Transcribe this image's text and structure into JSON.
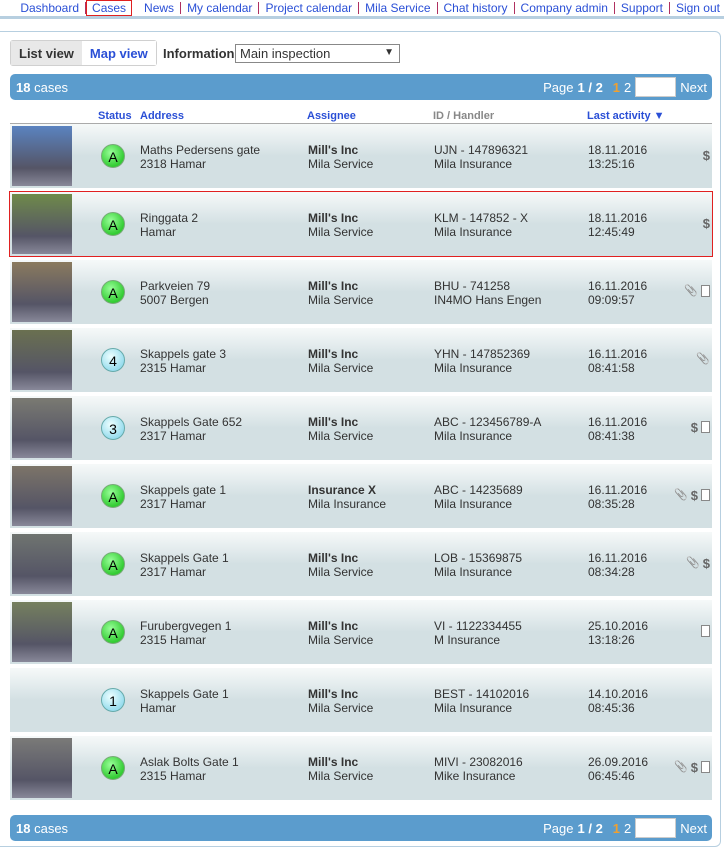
{
  "nav": [
    "Dashboard",
    "Cases",
    "News",
    "My calendar",
    "Project calendar",
    "Mila Service",
    "Chat history",
    "Company admin",
    "Support",
    "Sign out"
  ],
  "nav_active": "Cases",
  "view": {
    "list": "List view",
    "map": "Map view"
  },
  "info": {
    "label": "Information:",
    "value": "Main inspection"
  },
  "summary": {
    "count": "18",
    "count_label": "cases",
    "page_label": "Page",
    "page": "1 / 2",
    "current": "1",
    "other": "2",
    "next": "Next"
  },
  "headers": {
    "status": "Status",
    "address": "Address",
    "assignee": "Assignee",
    "id": "ID / Handler",
    "activity": "Last activity ▼"
  },
  "rows": [
    {
      "thumb": "#5a83c0",
      "status": "A",
      "color": "green",
      "addr1": "Maths Pedersens gate",
      "addr2": "2318 Hamar",
      "ass1": "Mill's Inc",
      "ass2": "Mila Service",
      "id1": "UJN - 147896321",
      "id2": "Mila Insurance",
      "date": "18.11.2016",
      "time": "13:25:16",
      "icons": [
        "dollar"
      ]
    },
    {
      "thumb": "#6f8a4a",
      "status": "A",
      "color": "green",
      "addr1": "Ringgata 2",
      "addr2": "Hamar",
      "ass1": "Mill's Inc",
      "ass2": "Mila Service",
      "id1": "KLM - 147852 - X",
      "id2": "Mila Insurance",
      "date": "18.11.2016",
      "time": "12:45:49",
      "icons": [
        "dollar"
      ],
      "selected": true
    },
    {
      "thumb": "#8a7a5e",
      "status": "A",
      "color": "green",
      "addr1": "Parkveien 79",
      "addr2": "5007 Bergen",
      "ass1": "Mill's Inc",
      "ass2": "Mila Service",
      "id1": "BHU - 741258",
      "id2": "IN4MO Hans Engen",
      "date": "16.11.2016",
      "time": "09:09:57",
      "icons": [
        "clip",
        "doc"
      ]
    },
    {
      "thumb": "#6a7050",
      "status": "4",
      "color": "cyan",
      "addr1": "Skappels gate 3",
      "addr2": "2315 Hamar",
      "ass1": "Mill's Inc",
      "ass2": "Mila Service",
      "id1": "YHN - 147852369",
      "id2": "Mila Insurance",
      "date": "16.11.2016",
      "time": "08:41:58",
      "icons": [
        "clip"
      ]
    },
    {
      "thumb": "#7a7a72",
      "status": "3",
      "color": "cyan",
      "addr1": "Skappels Gate 652",
      "addr2": "2317 Hamar",
      "ass1": "Mill's Inc",
      "ass2": "Mila Service",
      "id1": "ABC - 123456789-A",
      "id2": "Mila Insurance",
      "date": "16.11.2016",
      "time": "08:41:38",
      "icons": [
        "dollar",
        "doc"
      ]
    },
    {
      "thumb": "#7c7468",
      "status": "A",
      "color": "green",
      "addr1": "Skappels gate 1",
      "addr2": "2317 Hamar",
      "ass1": "Insurance X",
      "ass2": "Mila Insurance",
      "id1": "ABC - 14235689",
      "id2": "Mila Insurance",
      "date": "16.11.2016",
      "time": "08:35:28",
      "icons": [
        "clip",
        "dollar",
        "doc"
      ]
    },
    {
      "thumb": "#6f7470",
      "status": "A",
      "color": "green",
      "addr1": "Skappels Gate 1",
      "addr2": "2317 Hamar",
      "ass1": "Mill's Inc",
      "ass2": "Mila Service",
      "id1": "LOB - 15369875",
      "id2": "Mila Insurance",
      "date": "16.11.2016",
      "time": "08:34:28",
      "icons": [
        "clip",
        "dollar"
      ]
    },
    {
      "thumb": "#75805e",
      "status": "A",
      "color": "green",
      "addr1": "Furubergvegen 1",
      "addr2": "2315 Hamar",
      "ass1": "Mill's Inc",
      "ass2": "Mila Service",
      "id1": "VI - 1122334455",
      "id2": "M Insurance",
      "date": "25.10.2016",
      "time": "13:18:26",
      "icons": [
        "doc"
      ]
    },
    {
      "thumb": "",
      "status": "1",
      "color": "cyan",
      "addr1": "Skappels Gate 1",
      "addr2": "Hamar",
      "ass1": "Mill's Inc",
      "ass2": "Mila Service",
      "id1": "BEST - 14102016",
      "id2": "Mila Insurance",
      "date": "14.10.2016",
      "time": "08:45:36",
      "icons": []
    },
    {
      "thumb": "#7a7a78",
      "status": "A",
      "color": "green",
      "addr1": "Aslak Bolts Gate 1",
      "addr2": "2315 Hamar",
      "ass1": "Mill's Inc",
      "ass2": "Mila Service",
      "id1": "MIVI - 23082016",
      "id2": "Mike Insurance",
      "date": "26.09.2016",
      "time": "06:45:46",
      "icons": [
        "clip",
        "dollar",
        "doc"
      ]
    }
  ]
}
